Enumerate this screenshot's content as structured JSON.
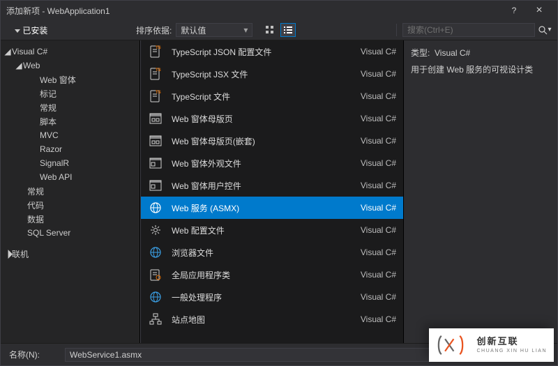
{
  "window": {
    "title": "添加新项 - WebApplication1",
    "help_tooltip": "?",
    "close_tooltip": "×"
  },
  "topbar": {
    "installed_label": "已安装",
    "sort_label": "排序依据:",
    "sort_value": "默认值",
    "search_placeholder": "搜索(Ctrl+E)"
  },
  "tree": {
    "root": {
      "label": "Visual C#"
    },
    "web": {
      "label": "Web"
    },
    "web_children": [
      "Web 窗体",
      "标记",
      "常规",
      "脚本",
      "MVC",
      "Razor",
      "SignalR",
      "Web API"
    ],
    "siblings": [
      "常规",
      "代码",
      "数据",
      "SQL Server"
    ],
    "online": {
      "label": "联机"
    }
  },
  "items": [
    {
      "name": "TypeScript JSON 配置文件",
      "lang": "Visual C#",
      "icon": "ts-json"
    },
    {
      "name": "TypeScript JSX 文件",
      "lang": "Visual C#",
      "icon": "ts-jsx"
    },
    {
      "name": "TypeScript 文件",
      "lang": "Visual C#",
      "icon": "ts"
    },
    {
      "name": "Web 窗体母版页",
      "lang": "Visual C#",
      "icon": "master"
    },
    {
      "name": "Web 窗体母版页(嵌套)",
      "lang": "Visual C#",
      "icon": "master"
    },
    {
      "name": "Web 窗体外观文件",
      "lang": "Visual C#",
      "icon": "skin"
    },
    {
      "name": "Web 窗体用户控件",
      "lang": "Visual C#",
      "icon": "usercontrol"
    },
    {
      "name": "Web 服务 (ASMX)",
      "lang": "Visual C#",
      "icon": "globe",
      "selected": true
    },
    {
      "name": "Web 配置文件",
      "lang": "Visual C#",
      "icon": "config"
    },
    {
      "name": "浏览器文件",
      "lang": "Visual C#",
      "icon": "globe2"
    },
    {
      "name": "全局应用程序类",
      "lang": "Visual C#",
      "icon": "global"
    },
    {
      "name": "一般处理程序",
      "lang": "Visual C#",
      "icon": "globe3"
    },
    {
      "name": "站点地图",
      "lang": "Visual C#",
      "icon": "sitemap"
    }
  ],
  "details": {
    "type_label": "类型:",
    "type_value": "Visual C#",
    "description": "用于创建 Web 服务的可视设计类"
  },
  "footer": {
    "name_label": "名称(N):",
    "name_value": "WebService1.asmx"
  },
  "watermark": {
    "big": "创新互联",
    "small": "CHUANG XIN HU LIAN"
  }
}
